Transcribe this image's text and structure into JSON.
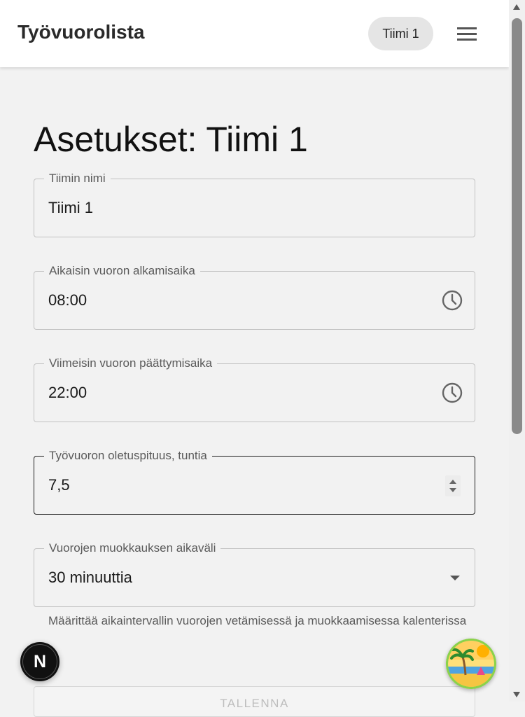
{
  "header": {
    "app_title": "Työvuorolista",
    "team_chip": "Tiimi 1",
    "menu_icon": "hamburger-menu-icon"
  },
  "page": {
    "title": "Asetukset: Tiimi 1"
  },
  "fields": {
    "team_name": {
      "label": "Tiimin nimi",
      "value": "Tiimi 1"
    },
    "earliest_start": {
      "label": "Aikaisin vuoron alkamisaika",
      "value": "08:00",
      "icon": "clock-icon"
    },
    "latest_end": {
      "label": "Viimeisin vuoron päättymisaika",
      "value": "22:00",
      "icon": "clock-icon"
    },
    "default_length": {
      "label": "Työvuoron oletuspituus, tuntia",
      "value": "7,5",
      "icon": "stepper-icon"
    },
    "edit_interval": {
      "label": "Vuorojen muokkauksen aikaväli",
      "value": "30 minuuttia",
      "icon": "chevron-down-icon",
      "helper": "Määrittää aikaintervallin vuorojen vetämisessä ja muokkaamisessa kalenterissa"
    }
  },
  "actions": {
    "save_label": "TALLENNA"
  },
  "overlays": {
    "next_badge_label": "N",
    "beach_icon": "beach-avatar-icon"
  },
  "colors": {
    "background": "#f2f2f2",
    "appbar": "#ffffff",
    "chip": "#e5e5e5",
    "border": "#c2c2c2",
    "focused_border": "#1e1e1e",
    "label": "#5a5a5a"
  }
}
